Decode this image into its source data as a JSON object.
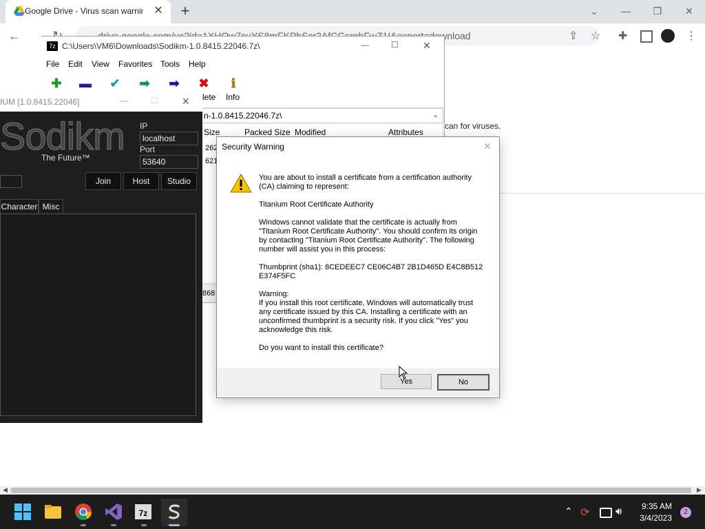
{
  "chrome": {
    "tab_title": "Google Drive - Virus scan warnin",
    "url": "drive.google.com/uc?id=1XHOw7cuYS8mFKPhScr2AfCGsrpbFwZ1I&export=download",
    "scan_text": "can for viruses."
  },
  "sevenzip": {
    "title": "C:\\Users\\VM6\\Downloads\\Sodikm-1.0.8415.22046.7z\\",
    "menu": [
      "File",
      "Edit",
      "View",
      "Favorites",
      "Tools",
      "Help"
    ],
    "tool_labels": {
      "delete": "lete",
      "info": "Info"
    },
    "path": "n-1.0.8415.22046.7z\\",
    "columns": [
      "Size",
      "Packed Size",
      "Modified",
      "Attributes"
    ],
    "row_sizes": [
      "262",
      "621"
    ],
    "status_partial": "868"
  },
  "sodikm": {
    "title": "IUM [1.0.8415.22046]",
    "logo": "Sodikm",
    "tagline": "The Future™",
    "ip_label": "IP",
    "ip_value": "localhost",
    "port_label": "Port",
    "port_value": "53640",
    "buttons": {
      "join": "Join",
      "host": "Host",
      "studio": "Studio"
    },
    "tabs": {
      "character": "Character",
      "misc": "Misc"
    }
  },
  "dialog": {
    "title": "Security Warning",
    "p1": "You are about to install a certificate from a certification authority (CA) claiming to represent:",
    "p2": "Titanium Root Certificate Authority",
    "p3": "Windows cannot validate that the certificate is actually from \"Titanium Root Certificate Authority\". You should confirm its origin by contacting \"Titanium Root Certificate Authority\". The following number will assist you in this process:",
    "p4": "Thumbprint (sha1): 8CEDEEC7 CE06C4B7 2B1D465D E4C8B512 E374F5FC",
    "p5_title": "Warning:",
    "p5": "If you install this root certificate, Windows will automatically trust any certificate issued by this CA. Installing a certificate with an unconfirmed thumbprint is a security risk. If you click \"Yes\" you acknowledge this risk.",
    "p6": "Do you want to install this certificate?",
    "yes": "Yes",
    "no": "No"
  },
  "taskbar": {
    "time": "9:35 AM",
    "date": "3/4/2023",
    "badge": "2"
  }
}
